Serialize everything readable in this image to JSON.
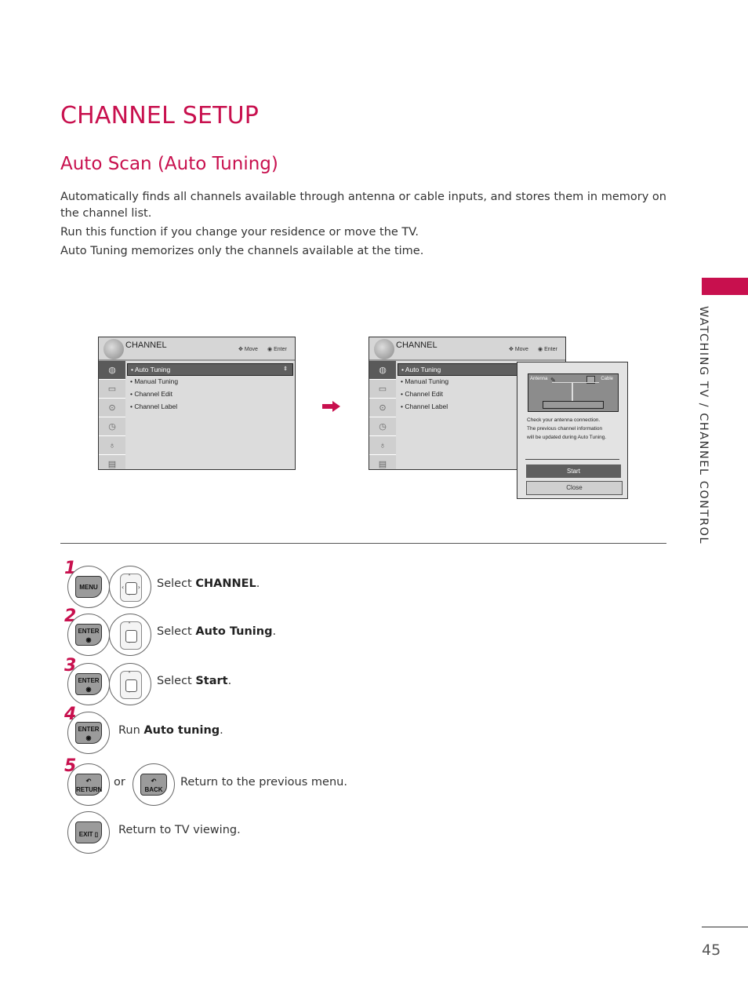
{
  "page": {
    "title": "CHANNEL SETUP",
    "subtitle": "Auto Scan (Auto Tuning)",
    "paragraphs": [
      "Automatically finds all channels available through antenna or cable inputs, and stores them in memory on the channel list.",
      "Run this function if you change your residence or move the TV.",
      "Auto Tuning memorizes only the channels available at the time."
    ],
    "side_label": "WATCHING TV / CHANNEL CONTROL",
    "page_number": "45",
    "accent_color": "#c8104e"
  },
  "menu": {
    "title": "CHANNEL",
    "hint_move": "Move",
    "hint_enter": "Enter",
    "items": [
      "Auto Tuning",
      "Manual Tuning",
      "Channel Edit",
      "Channel Label"
    ],
    "selected_index": 0,
    "side_icons": [
      "channel-icon",
      "picture-icon",
      "audio-icon",
      "time-icon",
      "lock-icon",
      "option-icon"
    ]
  },
  "popup": {
    "antenna_label": "Antenna",
    "cable_label": "Cable",
    "message_lines": [
      "Check your antenna connection.",
      "The previous channel information",
      "will be updated during Auto Tuning."
    ],
    "start_label": "Start",
    "close_label": "Close"
  },
  "steps": [
    {
      "number": "1",
      "keys": [
        "MENU",
        "navigation"
      ],
      "prefix": "Select ",
      "bold": "CHANNEL",
      "suffix": "."
    },
    {
      "number": "2",
      "keys": [
        "ENTER",
        "navigation"
      ],
      "prefix": "Select ",
      "bold": "Auto Tuning",
      "suffix": "."
    },
    {
      "number": "3",
      "keys": [
        "ENTER",
        "navigation"
      ],
      "prefix": "Select ",
      "bold": "Start",
      "suffix": "."
    },
    {
      "number": "4",
      "keys": [
        "ENTER"
      ],
      "prefix": "Run ",
      "bold": "Auto tuning",
      "suffix": "."
    },
    {
      "number": "5",
      "keys": [
        "RETURN",
        "BACK"
      ],
      "or_label": "or",
      "text": "Return to the previous menu."
    },
    {
      "number": "",
      "keys": [
        "EXIT"
      ],
      "text": "Return to TV viewing."
    }
  ]
}
